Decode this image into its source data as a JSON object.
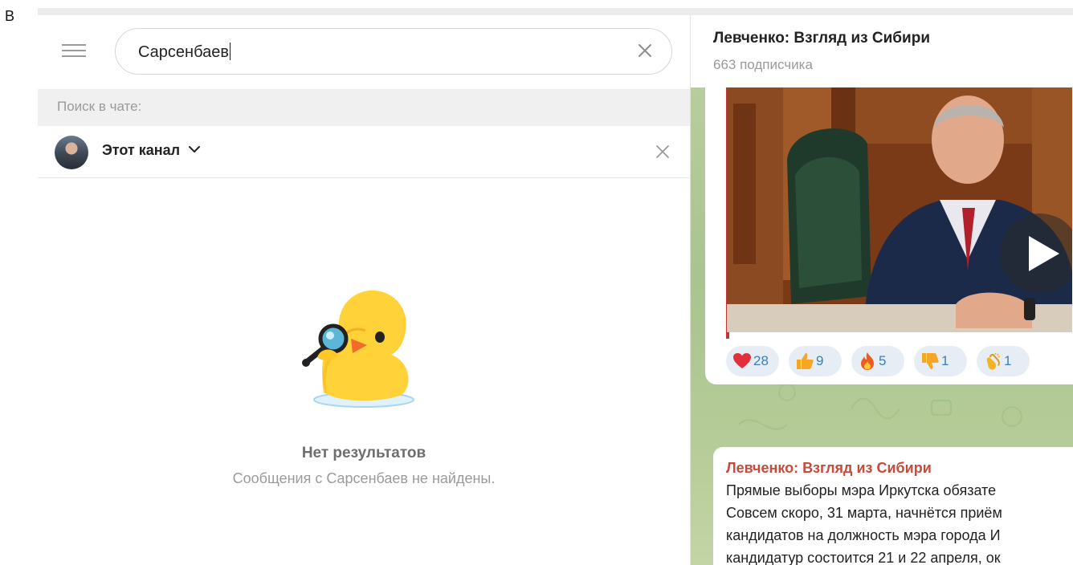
{
  "corner_label": "В",
  "search": {
    "query": "Сарсенбаев",
    "in_chat_label": "Поиск в чате:",
    "scope_label": "Этот канал"
  },
  "empty_state": {
    "title": "Нет результатов",
    "subtitle": "Сообщения с Сарсенбаев не найдены."
  },
  "channel": {
    "title": "Левченко: Взгляд из Сибири",
    "subscribers": "663 подписчика"
  },
  "reactions": [
    {
      "emoji": "heart-icon",
      "count": "28"
    },
    {
      "emoji": "thumbs-up-icon",
      "count": "9"
    },
    {
      "emoji": "fire-icon",
      "count": "5"
    },
    {
      "emoji": "thumbs-down-icon",
      "count": "1"
    },
    {
      "emoji": "clapping-hands-icon",
      "count": "1"
    }
  ],
  "message": {
    "author": "Левченко: Взгляд из Сибири",
    "lines": [
      "Прямые выборы мэра Иркутска обязате",
      "Совсем скоро, 31 марта, начнётся приём",
      "кандидатов на должность мэра города И",
      "кандидатур состоится 21 и 22 апреля, ок"
    ]
  },
  "colors": {
    "author_accent": "#c64b3b",
    "reaction_count": "#3a7fbf",
    "chat_background": "#b9cda4"
  }
}
